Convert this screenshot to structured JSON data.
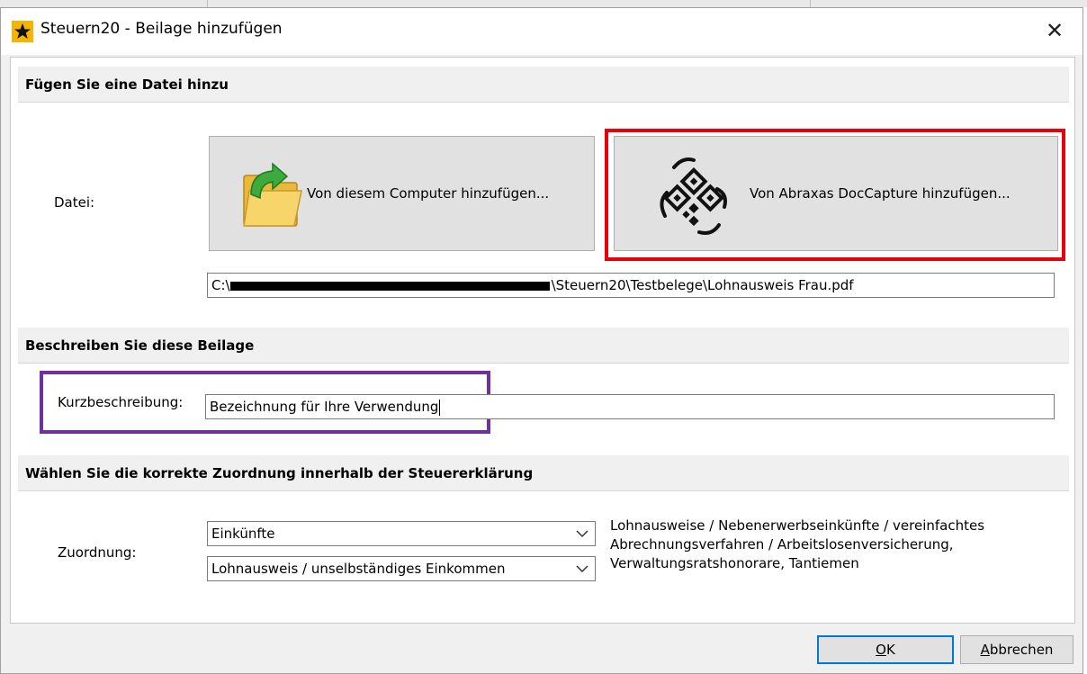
{
  "window": {
    "title": "Steuern20 - Beilage hinzufügen",
    "close_glyph": "✕"
  },
  "section_file": {
    "header": "Fügen Sie eine Datei hinzu",
    "label": "Datei:",
    "button_computer": "Von diesem Computer hinzufügen...",
    "button_doccapture": "Von Abraxas DocCapture hinzufügen...",
    "path_prefix": "C:\\",
    "path_suffix": "\\Steuern20\\Testbelege\\Lohnausweis Frau.pdf"
  },
  "section_describe": {
    "header": "Beschreiben Sie diese Beilage",
    "label": "Kurzbeschreibung:",
    "value": "Bezeichnung für Ihre Verwendung"
  },
  "section_assign": {
    "header": "Wählen Sie die korrekte Zuordnung innerhalb der Steuererklärung",
    "label": "Zuordnung:",
    "combo1": "Einkünfte",
    "combo2": "Lohnausweis / unselbständiges Einkommen",
    "description_lines": [
      "Lohnausweise / Nebenerwerbseinkünfte / vereinfachtes",
      "Abrechnungsverfahren / Arbeitslosenversicherung,",
      "Verwaltungsratshonorare, Tantiemen"
    ]
  },
  "buttons": {
    "ok_accel": "O",
    "ok_rest": "K",
    "cancel_accel": "A",
    "cancel_rest": "bbrechen"
  },
  "colors": {
    "highlight_red": "#e8000b",
    "highlight_purple": "#7030a0",
    "default_button_border": "#0078d7"
  },
  "icons": [
    "app-star-icon",
    "close-icon",
    "folder-arrow-icon",
    "qr-scan-icon",
    "chevron-down-icon"
  ]
}
